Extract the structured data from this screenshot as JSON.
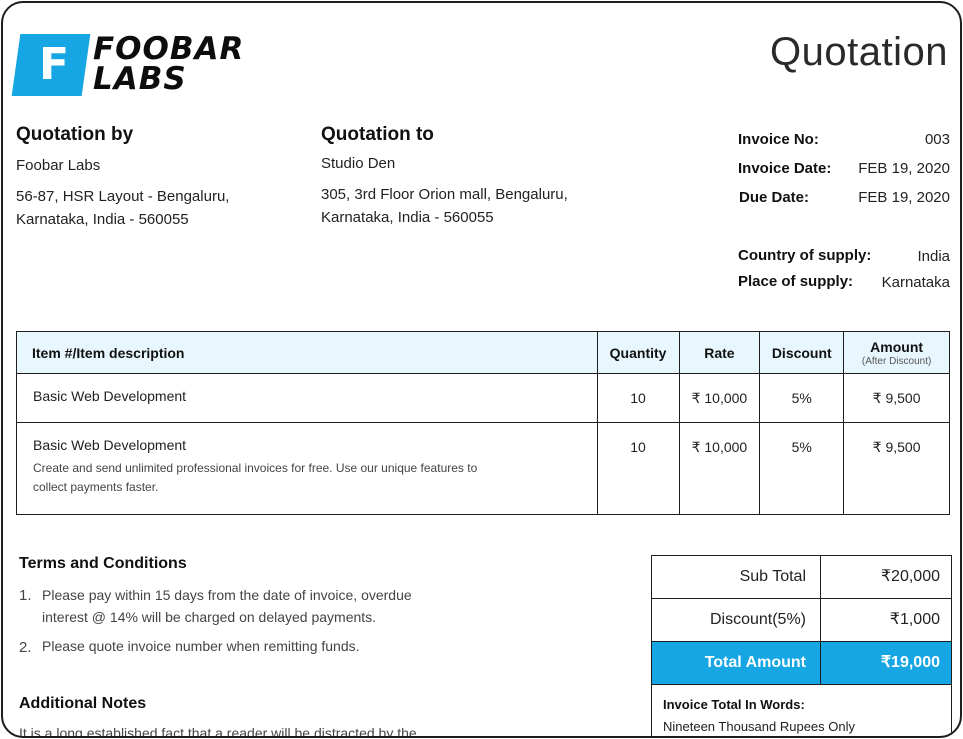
{
  "logo": {
    "letter": "F",
    "line1": "FOOBAR",
    "line2": "LABS"
  },
  "doc_title": "Quotation",
  "from": {
    "title": "Quotation by",
    "name": "Foobar Labs",
    "address1": "56-87, HSR Layout - Bengaluru,",
    "address2": "Karnataka, India - 560055"
  },
  "to": {
    "title": "Quotation to",
    "name": "Studio Den",
    "address1": "305, 3rd Floor Orion mall, Bengaluru,",
    "address2": "Karnataka, India - 560055"
  },
  "meta": {
    "invoice_no_label": "Invoice No:",
    "invoice_no": "003",
    "invoice_date_label": "Invoice Date:",
    "invoice_date": "FEB 19, 2020",
    "due_date_label": "Due Date:",
    "due_date": "FEB 19, 2020",
    "country_label": "Country of supply:",
    "country": "India",
    "place_label": "Place of supply:",
    "place": "Karnataka"
  },
  "table": {
    "headers": {
      "item": "Item #/Item description",
      "quantity": "Quantity",
      "rate": "Rate",
      "discount": "Discount",
      "amount": "Amount",
      "amount_sub": "(After Discount)"
    },
    "rows": [
      {
        "name": "Basic Web Development",
        "note": "",
        "quantity": "10",
        "rate": "₹ 10,000",
        "discount": "5%",
        "amount": "₹ 9,500"
      },
      {
        "name": "Basic Web Development",
        "note": "Create and send unlimited professional invoices for free. Use our unique features to collect payments faster.",
        "quantity": "10",
        "rate": "₹ 10,000",
        "discount": "5%",
        "amount": "₹ 9,500"
      }
    ]
  },
  "terms": {
    "title": "Terms and Conditions",
    "items": [
      {
        "num": "1.",
        "line1": "Please pay within 15 days from the date of invoice, overdue",
        "line2": "interest @ 14% will be charged on delayed payments."
      },
      {
        "num": "2.",
        "line1": "Please quote invoice number when remitting funds.",
        "line2": ""
      }
    ]
  },
  "notes": {
    "title": "Additional Notes",
    "text": "It is a long established fact that a reader will be distracted by the"
  },
  "totals": {
    "subtotal_label": "Sub Total",
    "subtotal": "₹20,000",
    "discount_label": "Discount(5%)",
    "discount": "₹1,000",
    "total_label": "Total Amount",
    "total": "₹19,000",
    "words_label": "Invoice Total In Words:",
    "words": "Nineteen Thousand Rupees Only"
  },
  "colors": {
    "accent": "#15a6e3",
    "header_bg": "#e8f7fd",
    "border": "#1e1e1e"
  }
}
